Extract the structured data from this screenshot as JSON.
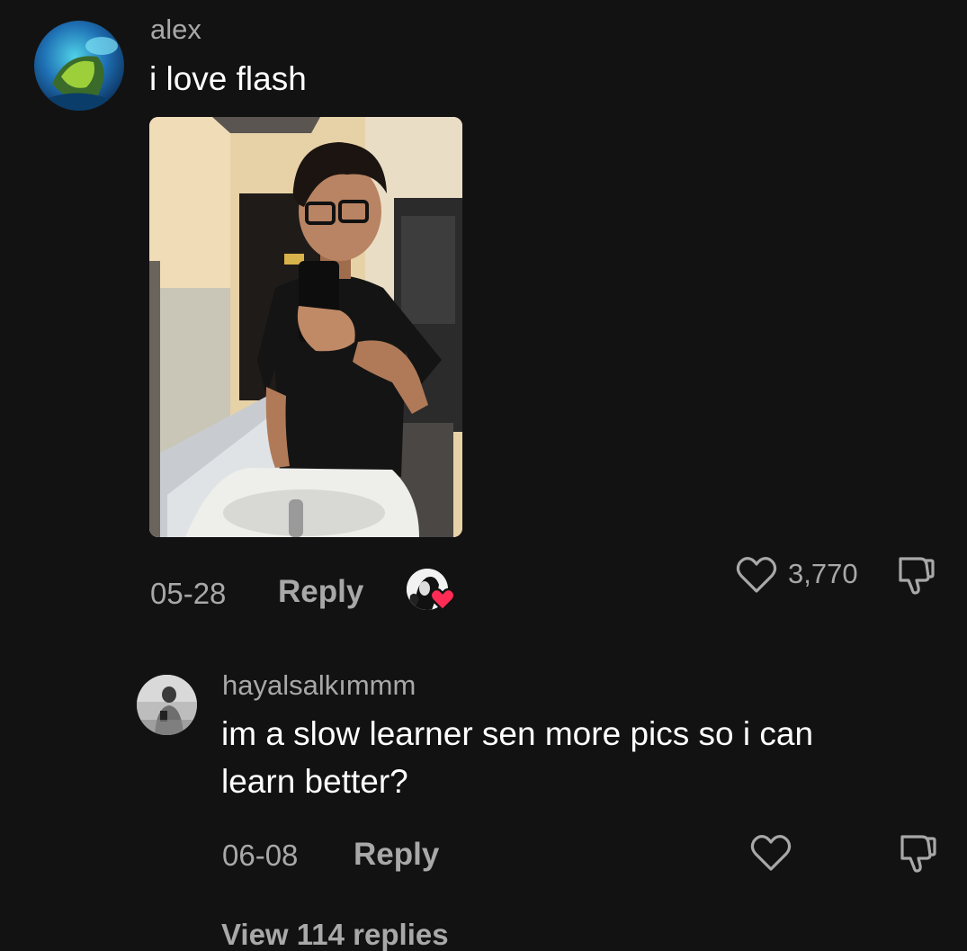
{
  "comments": [
    {
      "username": "alex",
      "text": "i love flash",
      "date": "05-28",
      "reply_label": "Reply",
      "like_count": "3,770"
    },
    {
      "username": "hayalsalkımmm",
      "text_line1": "im a slow learner sen more pics so i can",
      "text_line2": "learn better?",
      "date": "06-08",
      "reply_label": "Reply"
    }
  ],
  "view_replies": "View 114 replies",
  "colors": {
    "background": "#121212",
    "secondary_text": "#a8a8a8",
    "primary_text": "#ffffff",
    "heart_badge": "#fe2c55"
  },
  "icons": {
    "like": "heart-outline-icon",
    "dislike": "thumbs-down-icon",
    "liked_by_creator": "heart-badge-icon"
  }
}
